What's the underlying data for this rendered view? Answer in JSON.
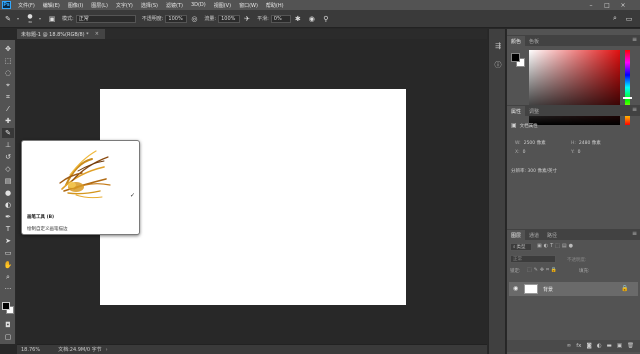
{
  "app": {
    "logo": "Ps",
    "menu": [
      "文件(F)",
      "编辑(E)",
      "图像(I)",
      "图层(L)",
      "文字(Y)",
      "选择(S)",
      "滤镜(T)",
      "3D(D)",
      "视图(V)",
      "窗口(W)",
      "帮助(H)"
    ]
  },
  "options": {
    "brush_size": "30",
    "mode_label": "模式:",
    "mode_value": "正常",
    "opacity_label": "不透明度:",
    "opacity_value": "100%",
    "flow_label": "流量:",
    "flow_value": "100%",
    "smooth_label": "平滑:",
    "smooth_value": "0%"
  },
  "document": {
    "tab_title": "未标题-1 @ 18.8%(RGB/8) *",
    "close": "×"
  },
  "tooltip": {
    "title": "画笔工具 (B)",
    "description": "绘制自定义画笔描边"
  },
  "status": {
    "zoom": "18.76%",
    "doc_info": "文档:24.9M/0 字节"
  },
  "panels": {
    "color_tabs": [
      "颜色",
      "色板"
    ],
    "props_tabs": [
      "属性",
      "调整"
    ],
    "props_title": "文档属性",
    "width_key": "W:",
    "width_value": "2500 像素",
    "height_key": "H:",
    "height_value": "2480 像素",
    "x_key": "X:",
    "x_value": "0",
    "y_key": "Y:",
    "y_value": "0",
    "resolution": "分辨率: 300 像素/英寸",
    "layers_tabs": [
      "图层",
      "通道",
      "路径"
    ],
    "kind_label": "类型",
    "blend_mode": "正常",
    "opacity_label": "不透明度:",
    "lock_label": "锁定:",
    "fill_label": "填充:",
    "layer_name": "背景"
  },
  "colors": {
    "accent": "#31a8ff",
    "foreground": "#000000",
    "background": "#ffffff",
    "hue": "#e01010"
  }
}
